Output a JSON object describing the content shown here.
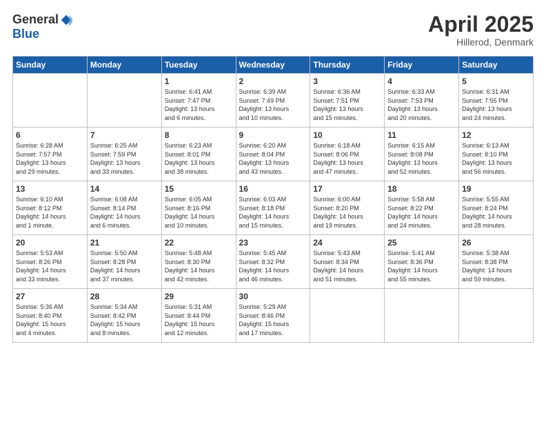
{
  "header": {
    "logo_general": "General",
    "logo_blue": "Blue",
    "title": "April 2025",
    "location": "Hillerod, Denmark"
  },
  "weekdays": [
    "Sunday",
    "Monday",
    "Tuesday",
    "Wednesday",
    "Thursday",
    "Friday",
    "Saturday"
  ],
  "weeks": [
    [
      {
        "day": "",
        "info": ""
      },
      {
        "day": "",
        "info": ""
      },
      {
        "day": "1",
        "info": "Sunrise: 6:41 AM\nSunset: 7:47 PM\nDaylight: 13 hours\nand 6 minutes."
      },
      {
        "day": "2",
        "info": "Sunrise: 6:39 AM\nSunset: 7:49 PM\nDaylight: 13 hours\nand 10 minutes."
      },
      {
        "day": "3",
        "info": "Sunrise: 6:36 AM\nSunset: 7:51 PM\nDaylight: 13 hours\nand 15 minutes."
      },
      {
        "day": "4",
        "info": "Sunrise: 6:33 AM\nSunset: 7:53 PM\nDaylight: 13 hours\nand 20 minutes."
      },
      {
        "day": "5",
        "info": "Sunrise: 6:31 AM\nSunset: 7:55 PM\nDaylight: 13 hours\nand 24 minutes."
      }
    ],
    [
      {
        "day": "6",
        "info": "Sunrise: 6:28 AM\nSunset: 7:57 PM\nDaylight: 13 hours\nand 29 minutes."
      },
      {
        "day": "7",
        "info": "Sunrise: 6:25 AM\nSunset: 7:59 PM\nDaylight: 13 hours\nand 33 minutes."
      },
      {
        "day": "8",
        "info": "Sunrise: 6:23 AM\nSunset: 8:01 PM\nDaylight: 13 hours\nand 38 minutes."
      },
      {
        "day": "9",
        "info": "Sunrise: 6:20 AM\nSunset: 8:04 PM\nDaylight: 13 hours\nand 43 minutes."
      },
      {
        "day": "10",
        "info": "Sunrise: 6:18 AM\nSunset: 8:06 PM\nDaylight: 13 hours\nand 47 minutes."
      },
      {
        "day": "11",
        "info": "Sunrise: 6:15 AM\nSunset: 8:08 PM\nDaylight: 13 hours\nand 52 minutes."
      },
      {
        "day": "12",
        "info": "Sunrise: 6:13 AM\nSunset: 8:10 PM\nDaylight: 13 hours\nand 56 minutes."
      }
    ],
    [
      {
        "day": "13",
        "info": "Sunrise: 6:10 AM\nSunset: 8:12 PM\nDaylight: 14 hours\nand 1 minute."
      },
      {
        "day": "14",
        "info": "Sunrise: 6:08 AM\nSunset: 8:14 PM\nDaylight: 14 hours\nand 6 minutes."
      },
      {
        "day": "15",
        "info": "Sunrise: 6:05 AM\nSunset: 8:16 PM\nDaylight: 14 hours\nand 10 minutes."
      },
      {
        "day": "16",
        "info": "Sunrise: 6:03 AM\nSunset: 8:18 PM\nDaylight: 14 hours\nand 15 minutes."
      },
      {
        "day": "17",
        "info": "Sunrise: 6:00 AM\nSunset: 8:20 PM\nDaylight: 14 hours\nand 19 minutes."
      },
      {
        "day": "18",
        "info": "Sunrise: 5:58 AM\nSunset: 8:22 PM\nDaylight: 14 hours\nand 24 minutes."
      },
      {
        "day": "19",
        "info": "Sunrise: 5:55 AM\nSunset: 8:24 PM\nDaylight: 14 hours\nand 28 minutes."
      }
    ],
    [
      {
        "day": "20",
        "info": "Sunrise: 5:53 AM\nSunset: 8:26 PM\nDaylight: 14 hours\nand 33 minutes."
      },
      {
        "day": "21",
        "info": "Sunrise: 5:50 AM\nSunset: 8:28 PM\nDaylight: 14 hours\nand 37 minutes."
      },
      {
        "day": "22",
        "info": "Sunrise: 5:48 AM\nSunset: 8:30 PM\nDaylight: 14 hours\nand 42 minutes."
      },
      {
        "day": "23",
        "info": "Sunrise: 5:45 AM\nSunset: 8:32 PM\nDaylight: 14 hours\nand 46 minutes."
      },
      {
        "day": "24",
        "info": "Sunrise: 5:43 AM\nSunset: 8:34 PM\nDaylight: 14 hours\nand 51 minutes."
      },
      {
        "day": "25",
        "info": "Sunrise: 5:41 AM\nSunset: 8:36 PM\nDaylight: 14 hours\nand 55 minutes."
      },
      {
        "day": "26",
        "info": "Sunrise: 5:38 AM\nSunset: 8:38 PM\nDaylight: 14 hours\nand 59 minutes."
      }
    ],
    [
      {
        "day": "27",
        "info": "Sunrise: 5:36 AM\nSunset: 8:40 PM\nDaylight: 15 hours\nand 4 minutes."
      },
      {
        "day": "28",
        "info": "Sunrise: 5:34 AM\nSunset: 8:42 PM\nDaylight: 15 hours\nand 8 minutes."
      },
      {
        "day": "29",
        "info": "Sunrise: 5:31 AM\nSunset: 8:44 PM\nDaylight: 15 hours\nand 12 minutes."
      },
      {
        "day": "30",
        "info": "Sunrise: 5:29 AM\nSunset: 8:46 PM\nDaylight: 15 hours\nand 17 minutes."
      },
      {
        "day": "",
        "info": ""
      },
      {
        "day": "",
        "info": ""
      },
      {
        "day": "",
        "info": ""
      }
    ]
  ]
}
